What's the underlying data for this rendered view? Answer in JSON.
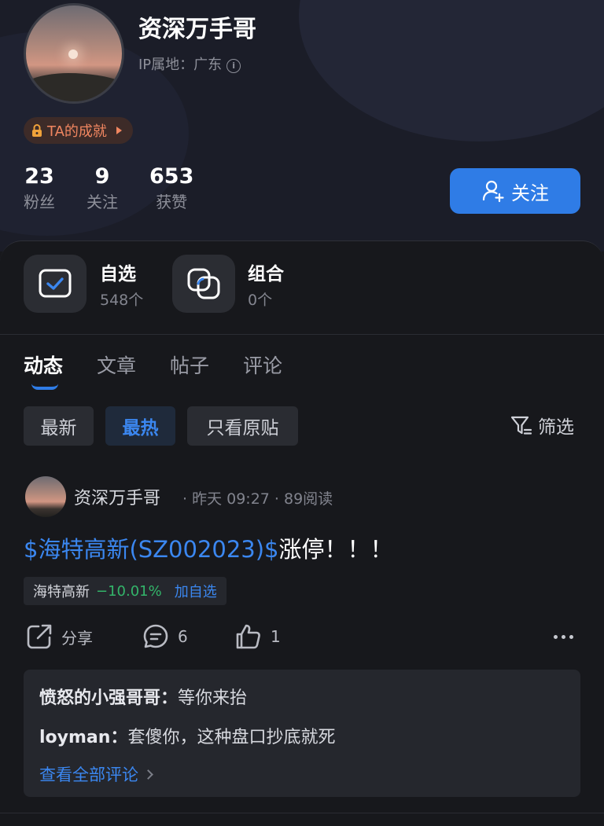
{
  "profile": {
    "name": "资深万手哥",
    "ip_location": "IP属地：广东",
    "achievement": "TA的成就",
    "follow_label": "关注",
    "stats": [
      {
        "value": "23",
        "label": "粉丝"
      },
      {
        "value": "9",
        "label": "关注"
      },
      {
        "value": "653",
        "label": "获赞"
      }
    ]
  },
  "tools": [
    {
      "title": "自选",
      "sub": "548个",
      "icon": "checkbox-icon"
    },
    {
      "title": "组合",
      "sub": "0个",
      "icon": "portfolio-icon"
    }
  ],
  "tabs": [
    "动态",
    "文章",
    "帖子",
    "评论"
  ],
  "active_tab": "动态",
  "filters": {
    "chips": [
      "最新",
      "最热",
      "只看原贴"
    ],
    "active_chip": "最热",
    "filter_label": "筛选"
  },
  "post": {
    "author": "资深万手哥",
    "meta": "· 昨天 09:27 · 89阅读",
    "body_stock": "$海特高新(SZ002023)$",
    "body_text": "涨停！！！",
    "stock_card": {
      "name": "海特高新",
      "change": "−10.01%",
      "add_label": "加自选"
    },
    "actions": {
      "share": "分享",
      "comments": "6",
      "likes": "1"
    },
    "comments": [
      {
        "author": "愤怒的小强哥哥：",
        "text": "等你来抬"
      },
      {
        "author": "loyman：",
        "text": "套傻你，这种盘口抄底就死"
      }
    ],
    "view_all": "查看全部评论"
  },
  "colors": {
    "accent": "#2f7ce6",
    "link": "#3b87f0",
    "down": "#33b56a",
    "background": "#17181c",
    "achievement": "#f08660"
  }
}
